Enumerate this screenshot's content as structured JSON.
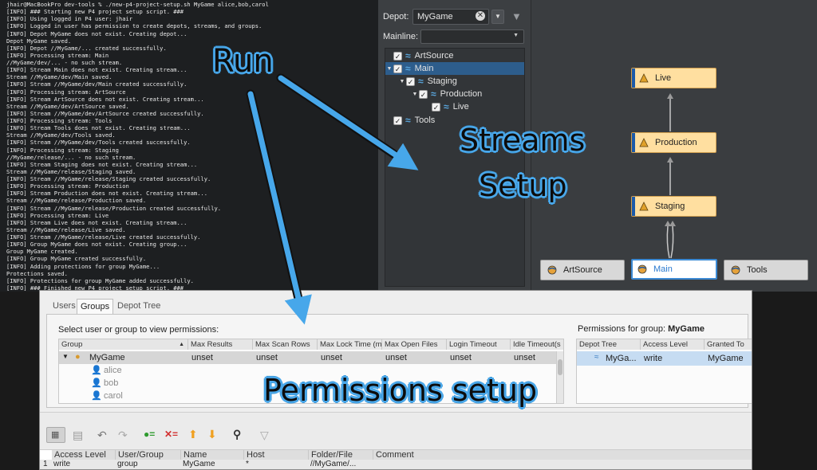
{
  "terminal": {
    "lines": [
      "jhair@MacBookPro dev-tools % ./new-p4-project-setup.sh MyGame alice,bob,carol",
      "[INFO] ### Starting new P4 project setup script. ###",
      "[INFO] Using logged in P4 user: jhair",
      "[INFO] Logged in user has permission to create depots, streams, and groups.",
      "[INFO] Depot MyGame does not exist. Creating depot...",
      "Depot MyGame saved.",
      "[INFO] Depot //MyGame/... created successfully.",
      "[INFO] Processing stream: Main",
      "//MyGame/dev/... - no such stream.",
      "[INFO] Stream Main does not exist. Creating stream...",
      "Stream //MyGame/dev/Main saved.",
      "[INFO] Stream //MyGame/dev/Main created successfully.",
      "[INFO] Processing stream: ArtSource",
      "[INFO] Stream ArtSource does not exist. Creating stream...",
      "Stream //MyGame/dev/ArtSource saved.",
      "[INFO] Stream //MyGame/dev/ArtSource created successfully.",
      "[INFO] Processing stream: Tools",
      "[INFO] Stream Tools does not exist. Creating stream...",
      "Stream //MyGame/dev/Tools saved.",
      "[INFO] Stream //MyGame/dev/Tools created successfully.",
      "[INFO] Processing stream: Staging",
      "//MyGame/release/... - no such stream.",
      "[INFO] Stream Staging does not exist. Creating stream...",
      "Stream //MyGame/release/Staging saved.",
      "[INFO] Stream //MyGame/release/Staging created successfully.",
      "[INFO] Processing stream: Production",
      "[INFO] Stream Production does not exist. Creating stream...",
      "Stream //MyGame/release/Production saved.",
      "[INFO] Stream //MyGame/release/Production created successfully.",
      "[INFO] Processing stream: Live",
      "[INFO] Stream Live does not exist. Creating stream...",
      "Stream //MyGame/release/Live saved.",
      "[INFO] Stream //MyGame/release/Live created successfully.",
      "[INFO] Group MyGame does not exist. Creating group...",
      "Group MyGame created.",
      "[INFO] Group MyGame created successfully.",
      "[INFO] Adding protections for group MyGame...",
      "Protections saved.",
      "[INFO] Protections for group MyGame added successfully.",
      "[INFO] ### Finished new P4 project setup script. ###"
    ]
  },
  "streams_panel": {
    "depot_label": "Depot:",
    "depot_value": "MyGame",
    "mainline_label": "Mainline:",
    "tree": [
      {
        "label": "ArtSource",
        "selected": false
      },
      {
        "label": "Main",
        "selected": true
      },
      {
        "label": "Staging",
        "selected": false
      },
      {
        "label": "Production",
        "selected": false
      },
      {
        "label": "Live",
        "selected": false
      },
      {
        "label": "Tools",
        "selected": false
      }
    ],
    "graph_nodes": {
      "live": "Live",
      "production": "Production",
      "staging": "Staging",
      "artsource": "ArtSource",
      "main": "Main",
      "tools": "Tools"
    }
  },
  "permissions": {
    "tabs": [
      "Users",
      "Groups",
      "Depot Tree"
    ],
    "active_tab": "Groups",
    "select_label": "Select user or group to view permissions:",
    "perm_for_label": "Permissions for group:",
    "perm_for_group": "MyGame",
    "columns": [
      "Group",
      "Max Results",
      "Max Scan Rows",
      "Max Lock Time (m",
      "Max Open Files",
      "Login Timeout",
      "Idle Timeout(s"
    ],
    "group_row": {
      "name": "MyGame",
      "values": [
        "unset",
        "unset",
        "unset",
        "unset",
        "unset",
        "unset"
      ]
    },
    "members": [
      "alice",
      "bob",
      "carol"
    ],
    "right_columns": [
      "Depot Tree",
      "Access Level",
      "Granted To"
    ],
    "right_row": {
      "depot": "MyGa...",
      "access": "write",
      "granted": "MyGame"
    },
    "rules_columns": [
      "Access Level",
      "User/Group",
      "Name",
      "Host",
      "Folder/File",
      "Comment"
    ],
    "rules_row": {
      "num": "1",
      "access": "write",
      "type": "group",
      "name": "MyGame",
      "host": "*",
      "path": "//MyGame/...",
      "comment": ""
    }
  },
  "callouts": {
    "run": "Run",
    "streams": "Streams",
    "setup": "Setup",
    "permissions": "Permissions setup"
  },
  "colors": {
    "callout_blue": "#4aa8ea",
    "stream_release": "#ffdfa0",
    "stream_mainline_border": "#3c8ad4",
    "tree_selection": "#2d5d8c"
  }
}
